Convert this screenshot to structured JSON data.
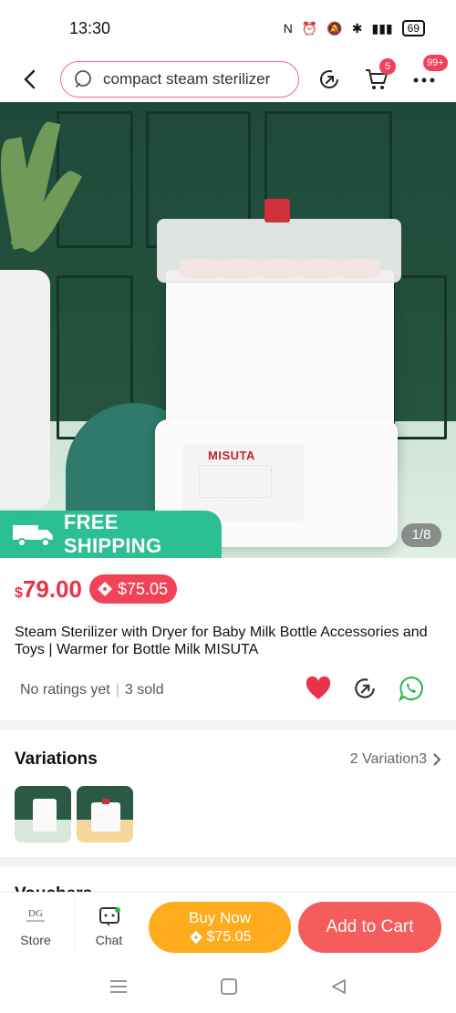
{
  "status_bar": {
    "time": "13:30",
    "battery": "69"
  },
  "search": {
    "query": "compact steam sterilizer"
  },
  "header": {
    "cart_count": "5",
    "more_count": "99+"
  },
  "hero": {
    "badge_small": "FREE",
    "free_shipping_label": "FREE SHIPPING",
    "image_counter": "1/8",
    "brand": "MISUTA"
  },
  "product": {
    "currency": "$",
    "price": "79.00",
    "promo_price": "$75.05",
    "title": "Steam Sterilizer with Dryer for Baby Milk Bottle Accessories and Toys  |  Warmer for Bottle Milk MISUTA",
    "rating_text": "No ratings yet",
    "sold_text": "3 sold"
  },
  "variations": {
    "title": "Variations",
    "count_text": "2 Variation3"
  },
  "vouchers": {
    "title": "Vouchers"
  },
  "bottom_bar": {
    "store_label": "Store",
    "chat_label": "Chat",
    "buy_now_label": "Buy Now",
    "buy_now_price": "$75.05",
    "add_to_cart_label": "Add to Cart"
  },
  "colors": {
    "accent": "#e8334a",
    "shipping": "#2bbf92",
    "buy_now": "#ffab1e",
    "add_cart": "#f45d5c"
  }
}
